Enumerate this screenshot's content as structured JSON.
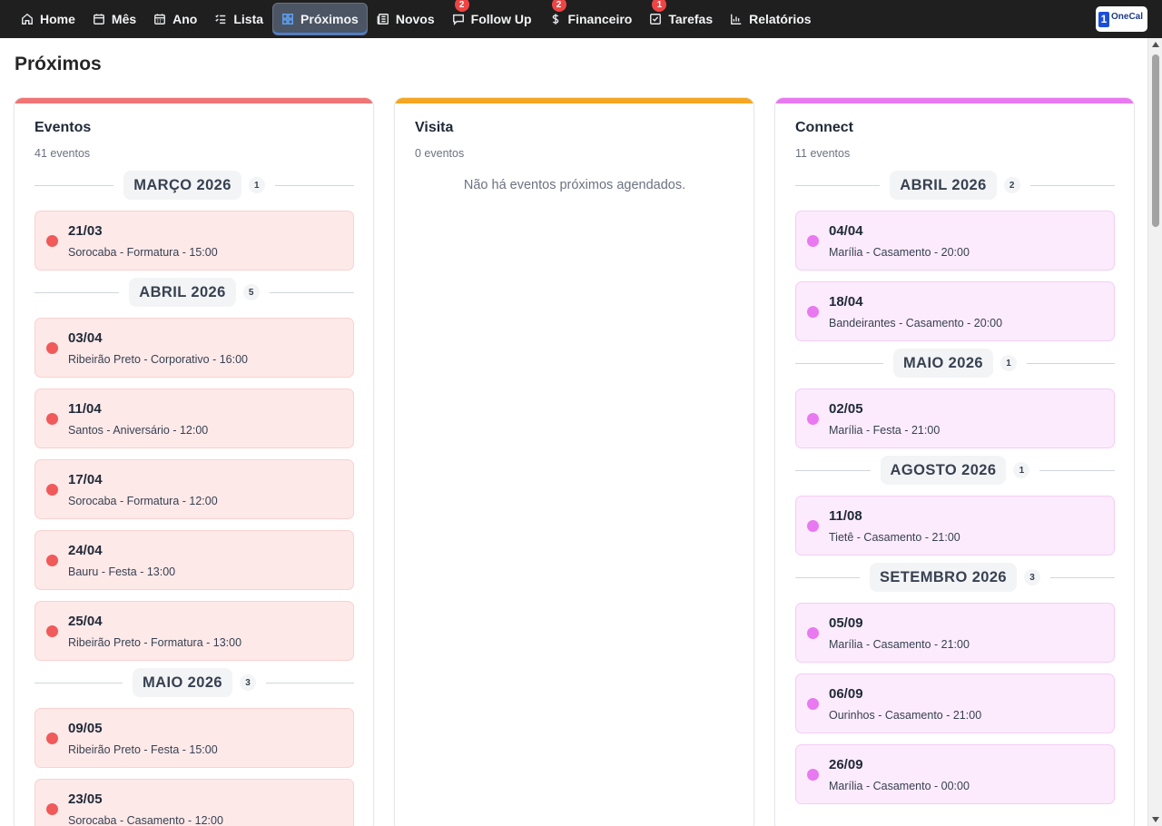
{
  "nav": {
    "items": [
      {
        "label": "Home",
        "icon": "home-icon"
      },
      {
        "label": "Mês",
        "icon": "calendar-icon"
      },
      {
        "label": "Ano",
        "icon": "calendar-grid-icon"
      },
      {
        "label": "Lista",
        "icon": "list-icon"
      },
      {
        "label": "Próximos",
        "icon": "grid-icon",
        "active": true
      },
      {
        "label": "Novos",
        "icon": "newspaper-icon"
      },
      {
        "label": "Follow Up",
        "icon": "message-icon",
        "badge": "2"
      },
      {
        "label": "Financeiro",
        "icon": "dollar-icon",
        "badge": "2"
      },
      {
        "label": "Tarefas",
        "icon": "checkbox-icon",
        "badge": "1"
      },
      {
        "label": "Relatórios",
        "icon": "bar-chart-icon"
      }
    ],
    "logo": {
      "mark": "1",
      "text": "OneCal"
    }
  },
  "page": {
    "title": "Próximos"
  },
  "colors": {
    "eventos": "#f07575",
    "visita": "#f5a623",
    "connect": "#e879f0",
    "nav_bg": "#1f1f1f"
  },
  "columns": [
    {
      "title": "Eventos",
      "count": "41 eventos",
      "style": "red",
      "groups": [
        {
          "month": "MARÇO 2026",
          "badge": "1",
          "events": [
            {
              "date": "21/03",
              "desc": "Sorocaba - Formatura - 15:00"
            }
          ]
        },
        {
          "month": "ABRIL 2026",
          "badge": "5",
          "events": [
            {
              "date": "03/04",
              "desc": "Ribeirão Preto - Corporativo - 16:00"
            },
            {
              "date": "11/04",
              "desc": "Santos - Aniversário - 12:00"
            },
            {
              "date": "17/04",
              "desc": "Sorocaba - Formatura - 12:00"
            },
            {
              "date": "24/04",
              "desc": "Bauru - Festa - 13:00"
            },
            {
              "date": "25/04",
              "desc": "Ribeirão Preto - Formatura - 13:00"
            }
          ]
        },
        {
          "month": "MAIO 2026",
          "badge": "3",
          "events": [
            {
              "date": "09/05",
              "desc": "Ribeirão Preto - Festa - 15:00"
            },
            {
              "date": "23/05",
              "desc": "Sorocaba - Casamento - 12:00"
            }
          ]
        }
      ]
    },
    {
      "title": "Visita",
      "count": "0 eventos",
      "style": "orange",
      "empty": "Não há eventos próximos agendados.",
      "groups": []
    },
    {
      "title": "Connect",
      "count": "11 eventos",
      "style": "pink",
      "groups": [
        {
          "month": "ABRIL 2026",
          "badge": "2",
          "events": [
            {
              "date": "04/04",
              "desc": "Marília - Casamento - 20:00"
            },
            {
              "date": "18/04",
              "desc": "Bandeirantes - Casamento - 20:00"
            }
          ]
        },
        {
          "month": "MAIO 2026",
          "badge": "1",
          "events": [
            {
              "date": "02/05",
              "desc": "Marília - Festa - 21:00"
            }
          ]
        },
        {
          "month": "AGOSTO 2026",
          "badge": "1",
          "events": [
            {
              "date": "11/08",
              "desc": "Tietê - Casamento - 21:00"
            }
          ]
        },
        {
          "month": "SETEMBRO 2026",
          "badge": "3",
          "events": [
            {
              "date": "05/09",
              "desc": "Marília - Casamento - 21:00"
            },
            {
              "date": "06/09",
              "desc": "Ourinhos - Casamento - 21:00"
            },
            {
              "date": "26/09",
              "desc": "Marília - Casamento - 00:00"
            }
          ]
        }
      ]
    }
  ]
}
